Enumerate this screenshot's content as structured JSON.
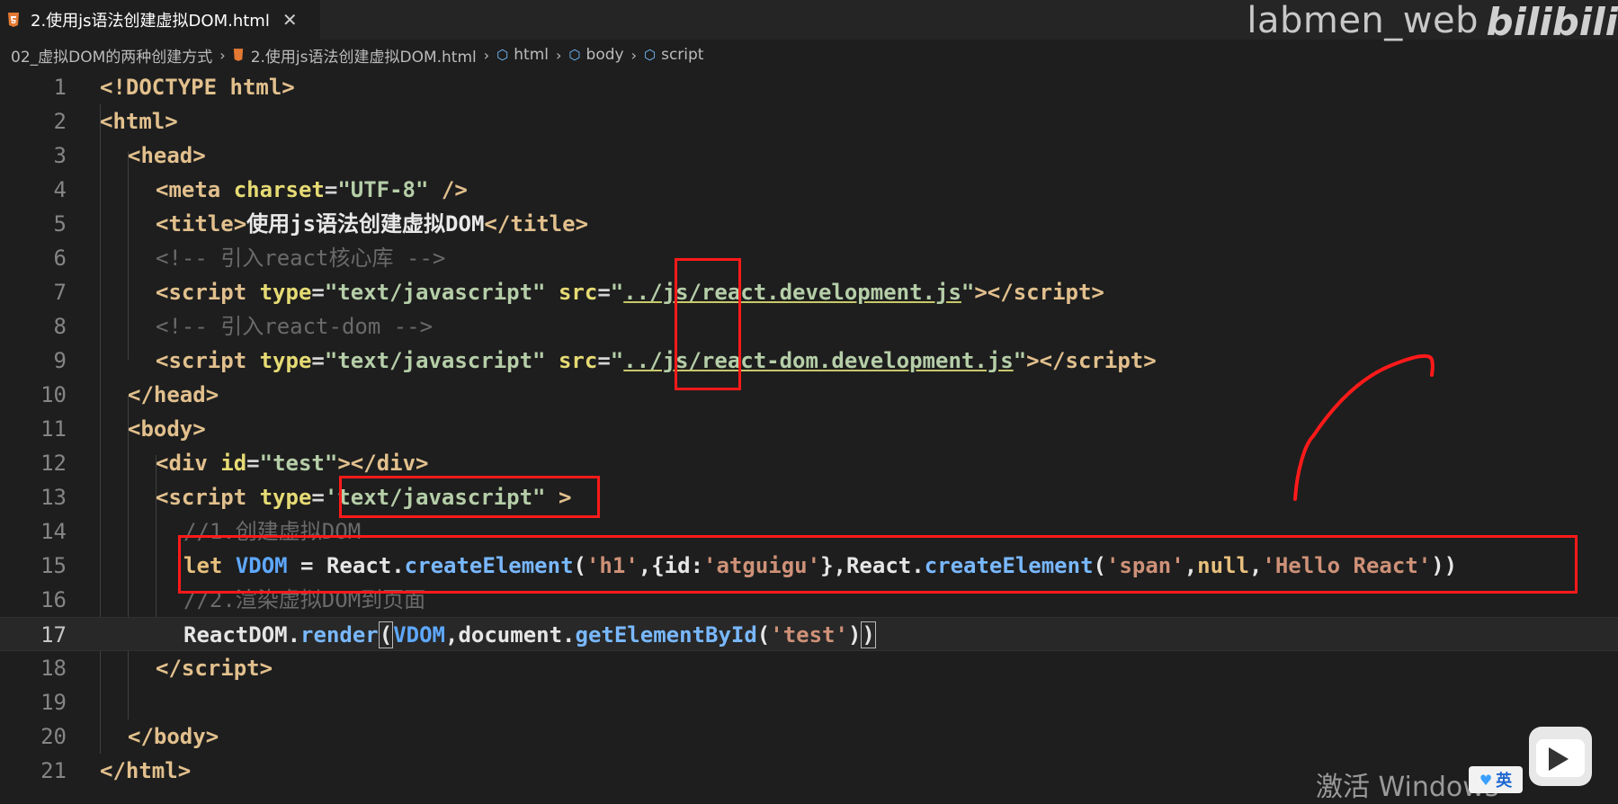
{
  "tab": {
    "filename": "2.使用js语法创建虚拟DOM.html",
    "close_glyph": "✕"
  },
  "watermark": {
    "channel": "labmen_web",
    "site": "bilibili"
  },
  "breadcrumb": {
    "folder": "02_虚拟DOM的两种创建方式",
    "file": "2.使用js语法创建虚拟DOM.html",
    "symbols": [
      "html",
      "body",
      "script"
    ]
  },
  "editor": {
    "active_line": 17,
    "lines": [
      {
        "n": "1"
      },
      {
        "n": "2"
      },
      {
        "n": "3"
      },
      {
        "n": "4"
      },
      {
        "n": "5"
      },
      {
        "n": "6"
      },
      {
        "n": "7"
      },
      {
        "n": "8"
      },
      {
        "n": "9"
      },
      {
        "n": "10"
      },
      {
        "n": "11"
      },
      {
        "n": "12"
      },
      {
        "n": "13"
      },
      {
        "n": "14"
      },
      {
        "n": "15"
      },
      {
        "n": "16"
      },
      {
        "n": "17"
      },
      {
        "n": "18"
      },
      {
        "n": "19"
      },
      {
        "n": "20"
      },
      {
        "n": "21"
      }
    ],
    "code": {
      "l1": "<!DOCTYPE html>",
      "l2_tag": "html",
      "l3_tag": "head",
      "l4_tag": "meta",
      "l4_attr": "charset",
      "l4_val": "\"UTF-8\"",
      "l5_tag": "title",
      "l5_text": "使用js语法创建虚拟DOM",
      "l6": "<!-- 引入react核心库 -->",
      "l7_tag": "script",
      "l7_attr1": "type",
      "l7_val1": "\"text/javascript\"",
      "l7_attr2": "src",
      "l7_val2_q": "\"",
      "l7_val2": "../js/react.development.js",
      "l8": "<!-- 引入react-dom -->",
      "l9_val2": "../js/react-dom.development.js",
      "l10_tag": "head",
      "l11_tag": "body",
      "l12_tag": "div",
      "l12_attr": "id",
      "l12_val": "\"test\"",
      "l13_val": "'text/javascript\"",
      "l14": "//1.创建虚拟DOM",
      "l15_kw": "let",
      "l15_var": "VDOM",
      "l15_eq": " = ",
      "l15_obj": "React",
      "l15_fn": "createElement",
      "l15_s1": "'h1'",
      "l15_key": "id",
      "l15_s2": "'atguigu'",
      "l15_s3": "'span'",
      "l15_null": "null",
      "l15_s4": "'Hello React'",
      "l16": "//2.渲染虚拟DOM到页面",
      "l17_obj": "ReactDOM",
      "l17_fn": "render",
      "l17_var": "VDOM",
      "l17_doc": "document",
      "l17_fn2": "getElementById",
      "l17_s": "'test'"
    }
  },
  "system": {
    "activate_text": "激活 Windows",
    "ime_label": "英"
  },
  "colors": {
    "annotation_red": "#ff1a1a",
    "editor_bg": "#1e1e1e",
    "html_icon": "#e37933"
  }
}
